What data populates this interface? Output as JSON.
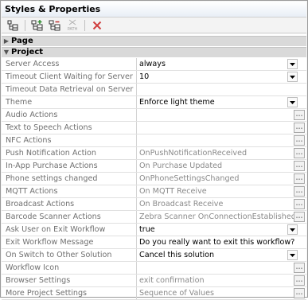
{
  "window": {
    "title": "Styles & Properties"
  },
  "toolbar": {
    "path_label": "PATH"
  },
  "categories": {
    "page": "Page",
    "project": "Project"
  },
  "rows": [
    {
      "name": "Server Access",
      "value": "always",
      "kind": "dropdown",
      "set": true
    },
    {
      "name": "Timeout Client Waiting for Server",
      "value": "10",
      "kind": "dropdown",
      "set": true
    },
    {
      "name": "Timeout Data Retrieval on Server",
      "value": "",
      "kind": "none",
      "set": false
    },
    {
      "name": "Theme",
      "value": "Enforce light theme",
      "kind": "dropdown",
      "set": true
    },
    {
      "name": "Audio Actions",
      "value": "",
      "kind": "ellipsis",
      "set": false
    },
    {
      "name": "Text to Speech Actions",
      "value": "",
      "kind": "ellipsis",
      "set": false
    },
    {
      "name": "NFC Actions",
      "value": "",
      "kind": "ellipsis",
      "set": false
    },
    {
      "name": "Push Notification Action",
      "value": "OnPushNotificationReceived",
      "kind": "ellipsis",
      "set": false
    },
    {
      "name": "In-App Purchase Actions",
      "value": "On Purchase Updated",
      "kind": "ellipsis",
      "set": false
    },
    {
      "name": "Phone settings changed",
      "value": "OnPhoneSettingsChanged",
      "kind": "ellipsis",
      "set": false
    },
    {
      "name": "MQTT Actions",
      "value": "On MQTT Receive",
      "kind": "ellipsis",
      "set": false
    },
    {
      "name": "Broadcast Actions",
      "value": "On Broadcast Receive",
      "kind": "ellipsis",
      "set": false
    },
    {
      "name": "Barcode Scanner Actions",
      "value": "Zebra Scanner OnConnectionEstablished",
      "kind": "ellipsis",
      "set": false
    },
    {
      "name": "Ask User on Exit Workflow",
      "value": "true",
      "kind": "dropdown",
      "set": true
    },
    {
      "name": "Exit Workflow Message",
      "value": "Do you really want to exit this workflow?",
      "kind": "none",
      "set": true
    },
    {
      "name": "On Switch to Other Solution",
      "value": "Cancel this solution",
      "kind": "dropdown",
      "set": true
    },
    {
      "name": "Workflow Icon",
      "value": "",
      "kind": "ellipsis",
      "set": false
    },
    {
      "name": "Browser Settings",
      "value": "exit confirmation",
      "kind": "ellipsis",
      "set": false
    },
    {
      "name": "More Project Settings",
      "value": "Sequence of Values",
      "kind": "ellipsis",
      "set": false
    }
  ],
  "ellipsis_label": "...",
  "colors": {
    "category_bg": "#d9d9d9",
    "title_gradient_end": "#e8eef6",
    "delete_icon": "#d04040"
  }
}
